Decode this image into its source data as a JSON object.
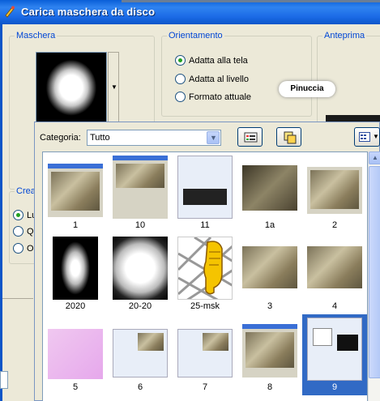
{
  "window": {
    "title": "Carica maschera da disco"
  },
  "groups": {
    "mask": "Maschera",
    "orientation": "Orientamento",
    "preview": "Anteprima",
    "create": "Crea"
  },
  "orientation_options": [
    {
      "label": "Adatta alla tela",
      "selected": true
    },
    {
      "label": "Adatta al livello",
      "selected": false
    },
    {
      "label": "Formato attuale",
      "selected": false
    }
  ],
  "create_options_partial": [
    "Lu",
    "Qu",
    "Op"
  ],
  "preview_logo": "Pinuccia",
  "browser": {
    "category_label": "Categoria:",
    "category_value": "Tutto",
    "thumbnails": [
      {
        "caption": "1"
      },
      {
        "caption": "10"
      },
      {
        "caption": "11"
      },
      {
        "caption": "1a"
      },
      {
        "caption": "2"
      },
      {
        "caption": "2020"
      },
      {
        "caption": "20-20"
      },
      {
        "caption": "25-msk"
      },
      {
        "caption": "3"
      },
      {
        "caption": "4"
      },
      {
        "caption": "5"
      },
      {
        "caption": "6"
      },
      {
        "caption": "7"
      },
      {
        "caption": "8"
      },
      {
        "caption": "9"
      }
    ],
    "selected_thumbnail": "9"
  }
}
